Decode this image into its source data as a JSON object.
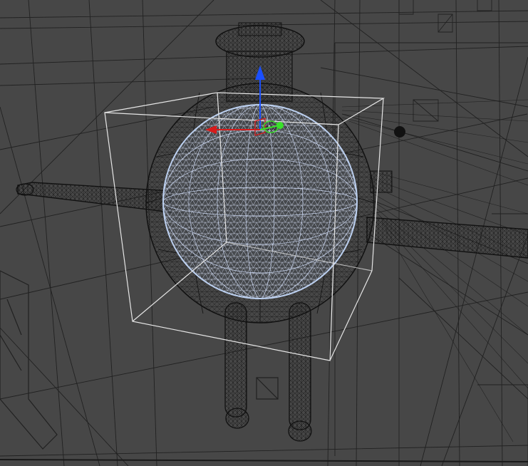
{
  "viewport": {
    "shading_mode": "wireframe",
    "background": "#474747",
    "wire_color": "#000000",
    "selection_color": "#c8dcff",
    "bounding_box_color": "#e8e8e8"
  },
  "scene": {
    "selected_object": "sphere",
    "objects": [
      "character-body",
      "character-head",
      "character-arm-left",
      "character-arm-right",
      "character-leg-left",
      "character-leg-right",
      "bounding-box",
      "environment-wireframe"
    ]
  },
  "gizmo": {
    "type": "translate",
    "x_axis_color": "#d81b1b",
    "y_axis_color": "#1a4fff",
    "z_axis_color": "#39e02a"
  }
}
